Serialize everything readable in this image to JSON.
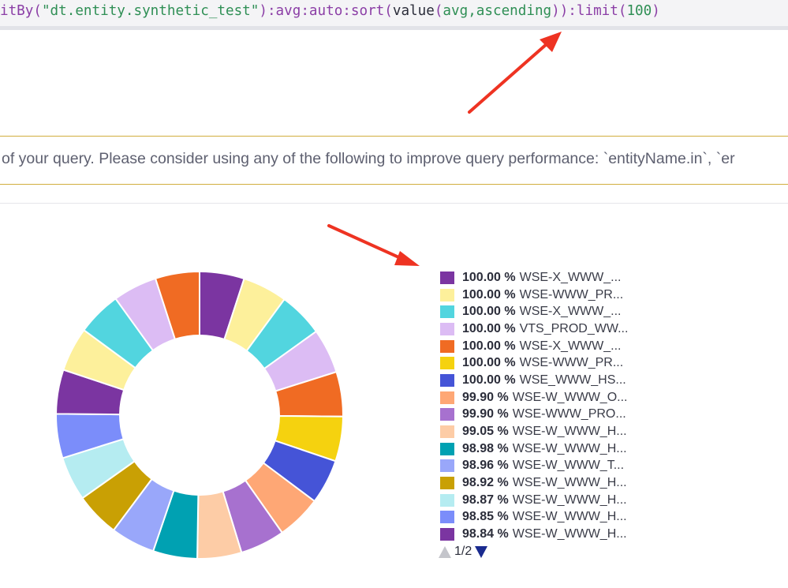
{
  "query": {
    "segments": [
      {
        "text": "itBy(",
        "kind": "fn"
      },
      {
        "text": "\"dt.entity.synthetic_test\"",
        "kind": "str"
      },
      {
        "text": "):avg:auto:sort(",
        "kind": "fn"
      },
      {
        "text": "value",
        "kind": "plain"
      },
      {
        "text": "(",
        "kind": "fn"
      },
      {
        "text": "avg,ascending",
        "kind": "str"
      },
      {
        "text": ")):limit(",
        "kind": "fn"
      },
      {
        "text": "100",
        "kind": "num"
      },
      {
        "text": ")",
        "kind": "fn"
      }
    ]
  },
  "warning": {
    "text": "of your query. Please consider using any of the following to improve query performance: `entityName.in`, `er"
  },
  "chart_data": {
    "type": "pie",
    "donut": true,
    "categories": [
      "WSE-X_WWW_...",
      "WSE-WWW_PR...",
      "WSE-X_WWW_...",
      "VTS_PROD_WW...",
      "WSE-X_WWW_...",
      "WSE-WWW_PR...",
      "WSE_WWW_HS...",
      "WSE-W_WWW_O...",
      "WSE-WWW_PRO...",
      "WSE-W_WWW_H...",
      "WSE-W_WWW_H...",
      "WSE-W_WWW_T...",
      "WSE-W_WWW_H...",
      "WSE-W_WWW_H...",
      "WSE-W_WWW_H...",
      "WSE-W_WWW_H...",
      "",
      "",
      "",
      ""
    ],
    "percent_labels": [
      "100.00 %",
      "100.00 %",
      "100.00 %",
      "100.00 %",
      "100.00 %",
      "100.00 %",
      "100.00 %",
      "99.90 %",
      "99.90 %",
      "99.05 %",
      "98.98 %",
      "98.96 %",
      "98.92 %",
      "98.87 %",
      "98.85 %",
      "98.84 %"
    ],
    "values": [
      100.0,
      100.0,
      100.0,
      100.0,
      100.0,
      100.0,
      100.0,
      99.9,
      99.9,
      99.05,
      98.98,
      98.96,
      98.92,
      98.87,
      98.85,
      98.84,
      98.8,
      98.8,
      98.8,
      98.8
    ],
    "colors": [
      "#7b35a1",
      "#fdf09b",
      "#52d5df",
      "#dcbcf4",
      "#f06b23",
      "#f5d20f",
      "#4554d7",
      "#fea775",
      "#a771cf",
      "#fdcca6",
      "#00a1b2",
      "#99a7fa",
      "#c9a004",
      "#b5ecf1",
      "#7b8dfa",
      "#7b35a1",
      "#fdf09b",
      "#52d5df",
      "#dcbcf4",
      "#f06b23"
    ],
    "legend_visible_count": 16,
    "legend_placement": "right",
    "start_angle_deg": 0
  },
  "pager": {
    "label": "1/2"
  },
  "icons": {
    "prev": "triangle-up-icon",
    "next": "triangle-down-icon",
    "annotation": "red-arrow-icon"
  },
  "annotation_color": "#ee3322"
}
